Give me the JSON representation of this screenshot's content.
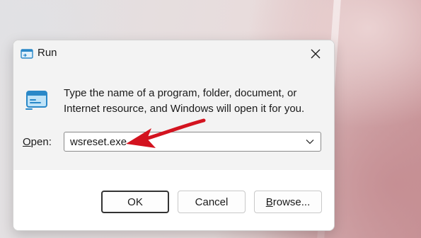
{
  "window": {
    "title": "Run",
    "description": "Type the name of a program, folder, document, or Internet resource, and Windows will open it for you.",
    "open_label_prefix": "O",
    "open_label_rest": "pen:",
    "command_value": "wsreset.exe"
  },
  "buttons": {
    "ok": "OK",
    "cancel": "Cancel",
    "browse_prefix": "B",
    "browse_rest": "rowse..."
  },
  "colors": {
    "annotation_arrow": "#d3131f",
    "run_icon_blue": "#2a88c8",
    "primary_button_border": "#333333"
  },
  "icons": {
    "title": "run-icon",
    "content": "run-program-icon",
    "close": "close-icon",
    "dropdown": "chevron-down-icon"
  }
}
